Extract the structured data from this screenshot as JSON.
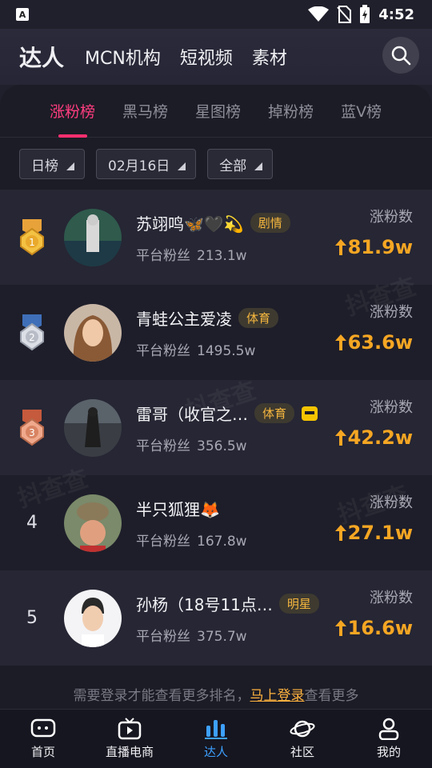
{
  "status": {
    "time": "4:52",
    "app_badge": "A"
  },
  "header": {
    "tabs": [
      "达人",
      "MCN机构",
      "短视频",
      "素材"
    ],
    "active_tab": "达人"
  },
  "rank_tabs": [
    "涨粉榜",
    "黑马榜",
    "星图榜",
    "掉粉榜",
    "蓝V榜"
  ],
  "active_rank_tab": "涨粉榜",
  "filters": {
    "period": "日榜",
    "date": "02月16日",
    "category": "全部"
  },
  "list": {
    "fans_label": "平台粉丝",
    "gain_label": "涨粉数",
    "items": [
      {
        "rank": "1",
        "name": "苏翊鸣🦋🖤💫",
        "tag": "剧情",
        "fans": "213.1w",
        "gain": "81.9w"
      },
      {
        "rank": "2",
        "name": "青蛙公主爱凌",
        "tag": "体育",
        "fans": "1495.5w",
        "gain": "63.6w"
      },
      {
        "rank": "3",
        "name": "雷哥（收官之…",
        "tag": "体育",
        "fans": "356.5w",
        "gain": "42.2w"
      },
      {
        "rank": "4",
        "name": "半只狐狸🦊",
        "tag": "",
        "fans": "167.8w",
        "gain": "27.1w"
      },
      {
        "rank": "5",
        "name": "孙杨（18号11点…",
        "tag": "明星",
        "fans": "375.7w",
        "gain": "16.6w"
      }
    ]
  },
  "login_hint": {
    "prefix": "需要登录才能查看更多排名，",
    "link": "马上登录",
    "suffix": "查看更多"
  },
  "bottom_nav": [
    "首页",
    "直播电商",
    "达人",
    "社区",
    "我的"
  ],
  "watermark": "抖查查",
  "colors": {
    "accent_pink": "#ff2f6e",
    "gain_orange": "#f5a623",
    "nav_active": "#3da0ff",
    "tag_text": "#f5b63e"
  }
}
